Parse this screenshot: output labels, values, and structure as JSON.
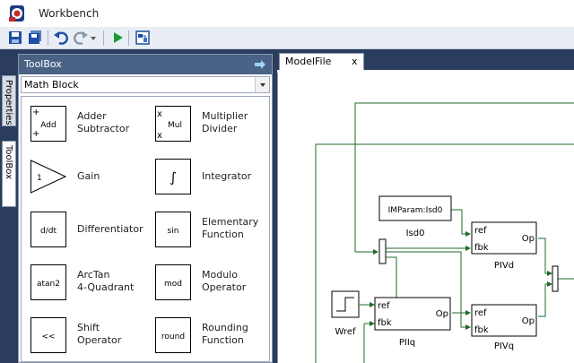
{
  "window": {
    "title": "Workbench"
  },
  "toolbar": {
    "buttons": [
      "save-icon",
      "save-all-icon",
      "undo-icon",
      "redo-icon",
      "dropdown-arrow-icon",
      "run-icon",
      "model-settings-icon"
    ]
  },
  "side_tabs": {
    "properties": "Properties",
    "toolbox": "ToolBox"
  },
  "toolbox": {
    "title": "ToolBox",
    "category": "Math Block",
    "blocks": [
      {
        "glyph": "Add",
        "label": "Adder\nSubtractor"
      },
      {
        "glyph": "Mul",
        "label": "Multiplier\nDivider"
      },
      {
        "glyph": "1",
        "label": "Gain"
      },
      {
        "glyph": "∫",
        "label": "Integrator"
      },
      {
        "glyph": "d/dt",
        "label": "Differentiator"
      },
      {
        "glyph": "sin",
        "label": "Elementary\nFunction"
      },
      {
        "glyph": "atan2",
        "label": "ArcTan\n4-Quadrant"
      },
      {
        "glyph": "mod",
        "label": "Modulo\nOperator"
      },
      {
        "glyph": "<<",
        "label": "Shift\nOperator"
      },
      {
        "glyph": "round",
        "label": "Rounding\nFunction"
      }
    ],
    "adder_signs": [
      "+",
      "+"
    ],
    "mul_signs": [
      "x",
      "x"
    ]
  },
  "document": {
    "tab_label": "ModelFile",
    "close_label": "x"
  },
  "diagram": {
    "param_block": "IMParam:Isd0",
    "param_name": "Isd0",
    "pi_blocks": [
      {
        "name": "PIVd",
        "in1": "ref",
        "in2": "fbk",
        "out": "Op"
      },
      {
        "name": "PIIq",
        "in1": "ref",
        "in2": "fbk",
        "out": "Op"
      },
      {
        "name": "PIVq",
        "in1": "ref",
        "in2": "fbk",
        "out": "Op"
      }
    ],
    "step_block": "Wref",
    "wire_color": "#1f6b2a"
  },
  "colors": {
    "panel_header": "#4a6285",
    "workspace": "#2b3d5e"
  }
}
